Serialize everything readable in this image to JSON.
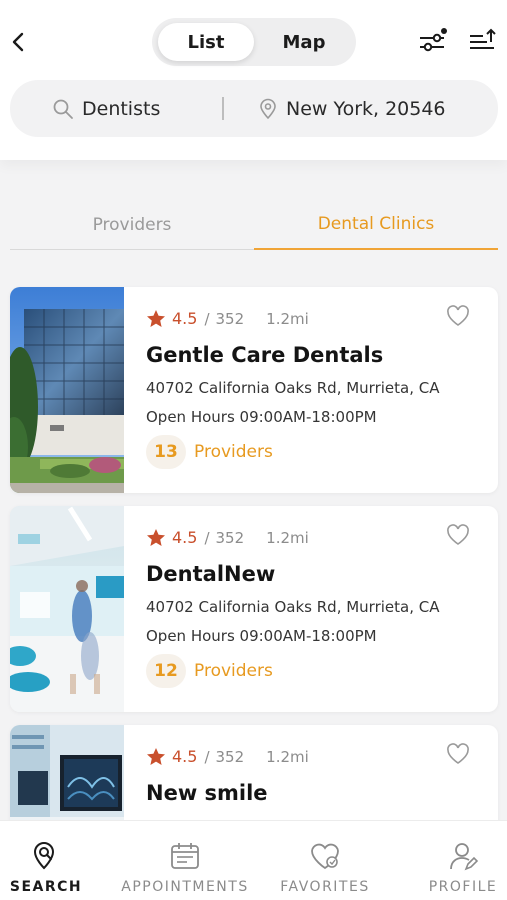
{
  "header": {
    "segment": {
      "list_label": "List",
      "map_label": "Map",
      "selected": "List"
    },
    "back_icon": "chevron-left-icon",
    "filter_icon": "filter-sliders-icon",
    "sort_icon": "sort-icon"
  },
  "search": {
    "query": "Dentists",
    "location": "New York, 20546",
    "query_icon": "search-icon",
    "location_icon": "location-pin-icon"
  },
  "tabs": [
    {
      "label": "Providers",
      "active": false
    },
    {
      "label": "Dental Clinics",
      "active": true
    }
  ],
  "clinics": [
    {
      "rating": "4.5",
      "reviews": "352",
      "distance": "1.2mi",
      "name": "Gentle Care Dentals",
      "address": "40702 California Oaks Rd, Murrieta, CA",
      "hours": "Open Hours 09:00AM-18:00PM",
      "providers_count": "13",
      "providers_label": "Providers"
    },
    {
      "rating": "4.5",
      "reviews": "352",
      "distance": "1.2mi",
      "name": "DentalNew",
      "address": "40702 California Oaks Rd, Murrieta, CA",
      "hours": "Open Hours 09:00AM-18:00PM",
      "providers_count": "12",
      "providers_label": "Providers"
    },
    {
      "rating": "4.5",
      "reviews": "352",
      "distance": "1.2mi",
      "name": "New smile"
    }
  ],
  "bottom_nav": [
    {
      "label": "SEARCH",
      "icon": "search-location-icon",
      "active": true
    },
    {
      "label": "APPOINTMENTS",
      "icon": "calendar-icon",
      "active": false
    },
    {
      "label": "FAVORITES",
      "icon": "heart-icon",
      "active": false
    },
    {
      "label": "PROFILE",
      "icon": "user-icon",
      "active": false
    }
  ],
  "colors": {
    "accent": "#e79a20",
    "rating_star": "#c9502d",
    "text": "#141414",
    "muted": "#8c8c8c"
  }
}
